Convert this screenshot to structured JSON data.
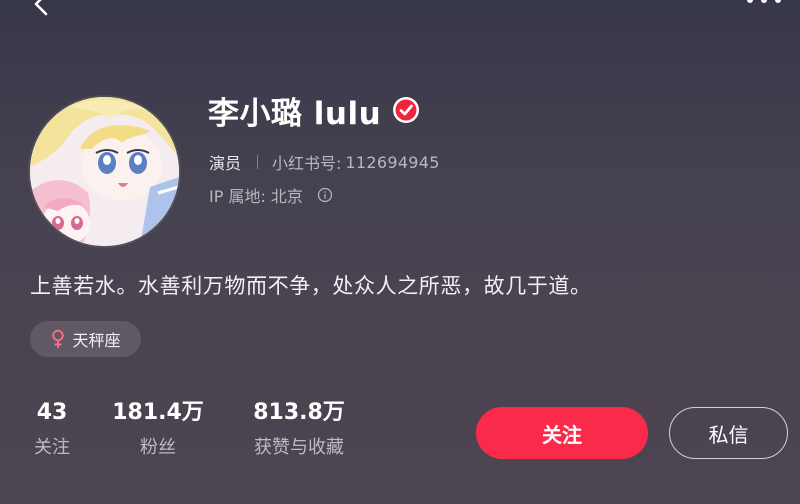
{
  "header": {
    "back_icon": "chevron-left-icon",
    "more_icon": "more-horizontal-icon"
  },
  "profile": {
    "avatar_icon": "anime-avatar",
    "nickname": "李小璐 lulu",
    "verified_icon": "verified-check-icon",
    "verified_color": "#f0243d",
    "role": "演员",
    "rid_label": "小红书号:",
    "rid_value": "112694945",
    "ip_label": "IP 属地: 北京",
    "info_icon": "info-circle-icon",
    "bio": "上善若水。水善利万物而不争，处众人之所恶，故几于道。",
    "tag": {
      "icon": "female-icon",
      "icon_color": "#ff6f85",
      "label": "天秤座"
    }
  },
  "stats": [
    {
      "value": "43",
      "label": "关注"
    },
    {
      "value": "181.4万",
      "label": "粉丝"
    },
    {
      "value": "813.8万",
      "label": "获赞与收藏"
    }
  ],
  "actions": {
    "follow_label": "关注",
    "follow_color": "#fa2a4b",
    "message_label": "私信"
  }
}
